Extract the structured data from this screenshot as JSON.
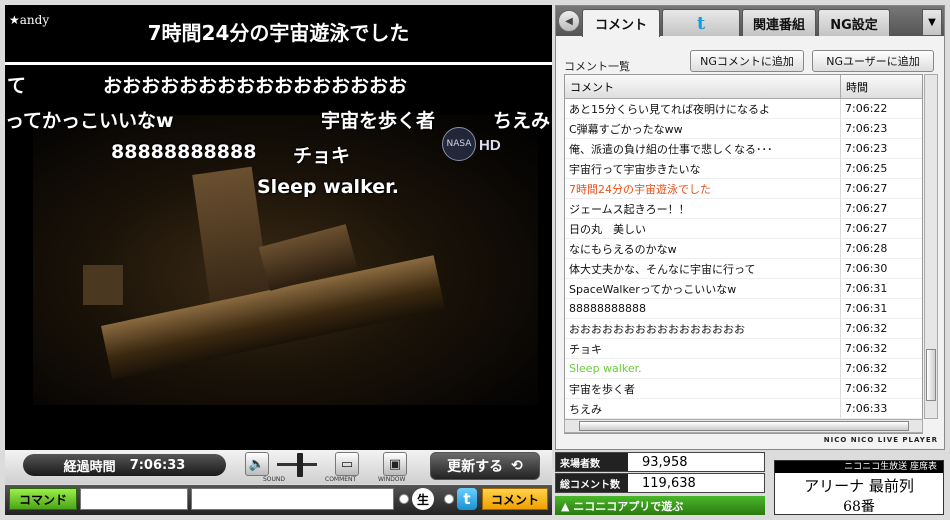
{
  "player": {
    "owner": "★andy",
    "owner_comment": "7時間24分の宇宙遊泳でした",
    "nasa_badge": "NASA",
    "hd_badge": "HD",
    "danmaku": [
      "て",
      "おおおおおおおおおおおおおおおお",
      "ってかっこいいなw",
      "宇宙を歩く者",
      "ちえみ",
      "88888888888",
      "チョキ",
      "Sleep walker."
    ]
  },
  "controls": {
    "elapsed_label": "経過時間",
    "elapsed_value": "7:06:33",
    "sound_label": "SOUND",
    "comment_label": "COMMENT",
    "window_label": "WINDOW",
    "refresh_label": "更新する"
  },
  "command_row": {
    "command_label": "コマンド",
    "live_icon": "生",
    "twitter_icon": "t",
    "submit_label": "コメント"
  },
  "tabs": {
    "comment": "コメント",
    "twitter": "t",
    "related": "関連番組",
    "ng": "NG設定"
  },
  "comment_panel": {
    "caption": "コメント一覧",
    "ng_comment_button": "NGコメントに追加",
    "ng_user_button": "NGユーザーに追加",
    "col_comment": "コメント",
    "col_time": "時間",
    "brand": "NICO NICO LIVE PLAYER",
    "rows": [
      {
        "comment": "あと15分くらい見てれば夜明けになるよ",
        "time": "7:06:22",
        "color": "#111111"
      },
      {
        "comment": "C弾幕すごかったなww",
        "time": "7:06:23",
        "color": "#111111"
      },
      {
        "comment": "俺、派遣の負け組の仕事で悲しくなる･･･",
        "time": "7:06:23",
        "color": "#111111"
      },
      {
        "comment": "宇宙行って宇宙歩きたいな",
        "time": "7:06:25",
        "color": "#111111"
      },
      {
        "comment": "7時間24分の宇宙遊泳でした",
        "time": "7:06:27",
        "color": "#e8501a"
      },
      {
        "comment": "ジェームス起きろー！！",
        "time": "7:06:27",
        "color": "#111111"
      },
      {
        "comment": "日の丸　美しい",
        "time": "7:06:27",
        "color": "#111111"
      },
      {
        "comment": "なにもらえるのかなw",
        "time": "7:06:28",
        "color": "#111111"
      },
      {
        "comment": "体大丈夫かな、そんなに宇宙に行って",
        "time": "7:06:30",
        "color": "#111111"
      },
      {
        "comment": "SpaceWalkerってかっこいいなw",
        "time": "7:06:31",
        "color": "#111111"
      },
      {
        "comment": "88888888888",
        "time": "7:06:31",
        "color": "#111111"
      },
      {
        "comment": "おおおおおおおおおおおおおおおお",
        "time": "7:06:32",
        "color": "#111111"
      },
      {
        "comment": "チョキ",
        "time": "7:06:32",
        "color": "#111111"
      },
      {
        "comment": "Sleep walker.",
        "time": "7:06:32",
        "color": "#6acc3a"
      },
      {
        "comment": "宇宙を歩く者",
        "time": "7:06:32",
        "color": "#111111"
      },
      {
        "comment": "ちえみ",
        "time": "7:06:33",
        "color": "#111111"
      }
    ]
  },
  "stats": {
    "visitors_label": "来場者数",
    "visitors_value": "93,958",
    "comments_label": "総コメント数",
    "comments_value": "119,638",
    "app_banner": "▲ ニコニコアプリで遊ぶ"
  },
  "seat": {
    "header": "ニコニコ生放送 座席表",
    "name": "アリーナ 最前列",
    "number": "68番"
  }
}
